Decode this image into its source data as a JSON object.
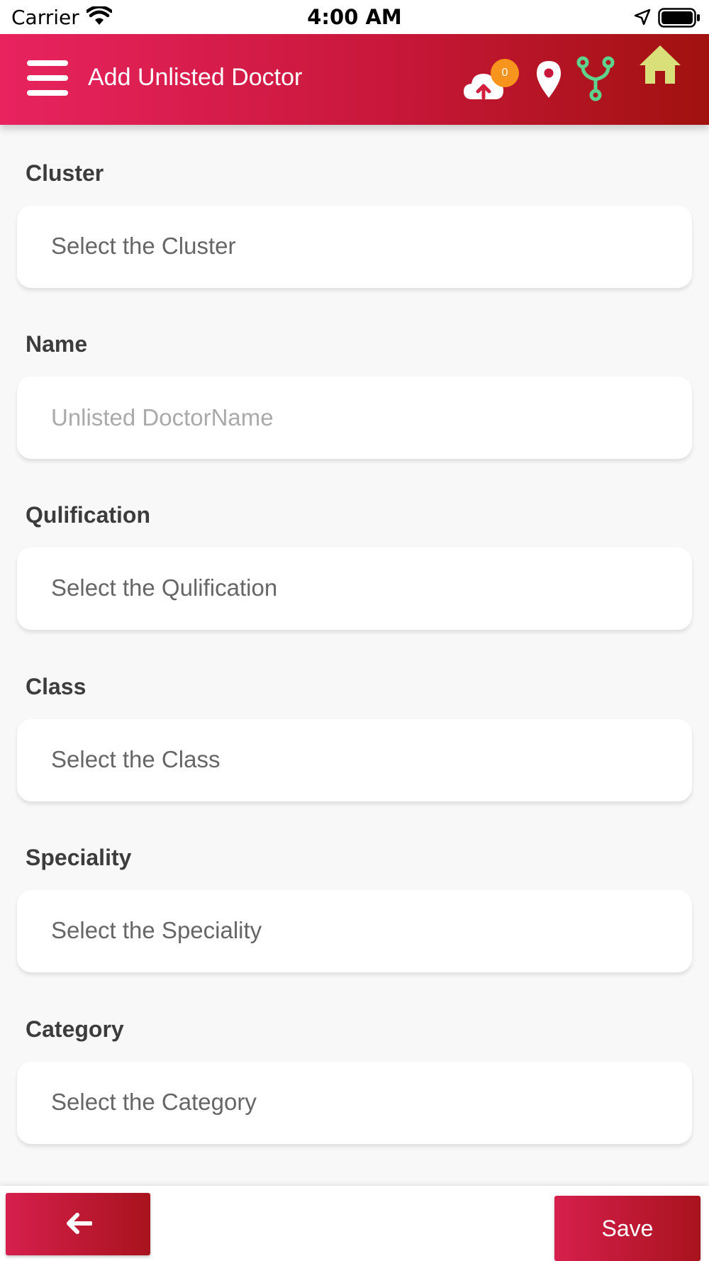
{
  "status_bar": {
    "carrier": "Carrier",
    "time": "4:00 AM"
  },
  "header": {
    "title": "Add Unlisted Doctor",
    "sync_badge_count": "0",
    "icons": [
      "menu-icon",
      "cloud-upload-icon",
      "location-pin-icon",
      "branch-icon",
      "home-icon"
    ],
    "colors": {
      "gradient_start": "#e8235f",
      "gradient_end": "#a1120f",
      "badge": "#f7941d",
      "branch_icon": "#5fd38d",
      "home_icon": "#d9e07a"
    }
  },
  "form": {
    "cluster": {
      "label": "Cluster",
      "value": "Select the Cluster"
    },
    "name": {
      "label": "Name",
      "placeholder": "Unlisted DoctorName"
    },
    "qualification": {
      "label": "Qulification",
      "value": "Select the Qulification"
    },
    "class": {
      "label": "Class",
      "value": "Select the Class"
    },
    "speciality": {
      "label": "Speciality",
      "value": "Select the Speciality"
    },
    "category": {
      "label": "Category",
      "value": "Select the Category"
    }
  },
  "footer": {
    "save_label": "Save",
    "back_icon": "arrow-left-icon"
  }
}
